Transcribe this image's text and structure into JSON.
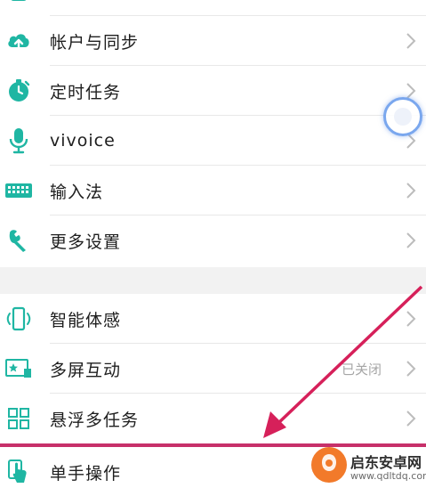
{
  "settings_top": [
    {
      "label": "帐户与同步",
      "icon": "cloud-sync-icon"
    },
    {
      "label": "定时任务",
      "icon": "timer-icon"
    },
    {
      "label": "vivoice",
      "icon": "microphone-icon"
    },
    {
      "label": "输入法",
      "icon": "keyboard-icon"
    },
    {
      "label": "更多设置",
      "icon": "wrench-icon"
    }
  ],
  "settings_bottom": [
    {
      "label": "智能体感",
      "icon": "motion-phone-icon",
      "value": ""
    },
    {
      "label": "多屏互动",
      "icon": "multi-screen-icon",
      "value": "已关闭"
    },
    {
      "label": "悬浮多任务",
      "icon": "float-multitask-icon",
      "value": ""
    },
    {
      "label": "单手操作",
      "icon": "one-hand-icon",
      "value": ""
    }
  ],
  "watermark": {
    "title": "启东安卓网",
    "url": "www.qdltdq.com"
  },
  "colors": {
    "accent": "#1fb6a3",
    "arrow": "#d6205a",
    "chevron": "#bcbcbc"
  }
}
